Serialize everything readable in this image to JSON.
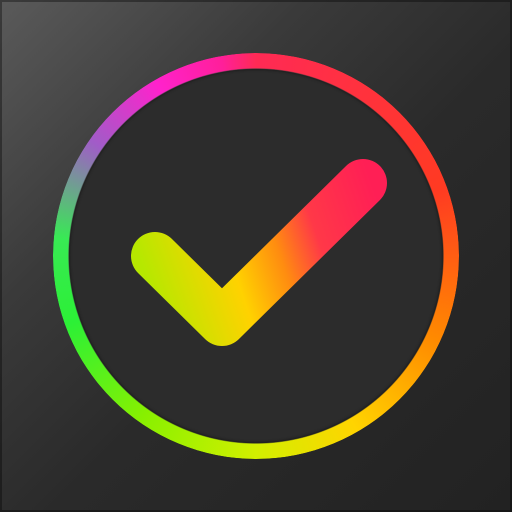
{
  "icon": {
    "name": "checkmark-app-icon",
    "background_color": "#2a2a2a",
    "ring_colors": [
      "#ff2a55",
      "#ff3a22",
      "#ff8a00",
      "#ffd400",
      "#88f000",
      "#2cf036",
      "#ff22cc"
    ],
    "check_colors": [
      "#b8e600",
      "#ffd400",
      "#ff8a00",
      "#ff2a55"
    ]
  }
}
